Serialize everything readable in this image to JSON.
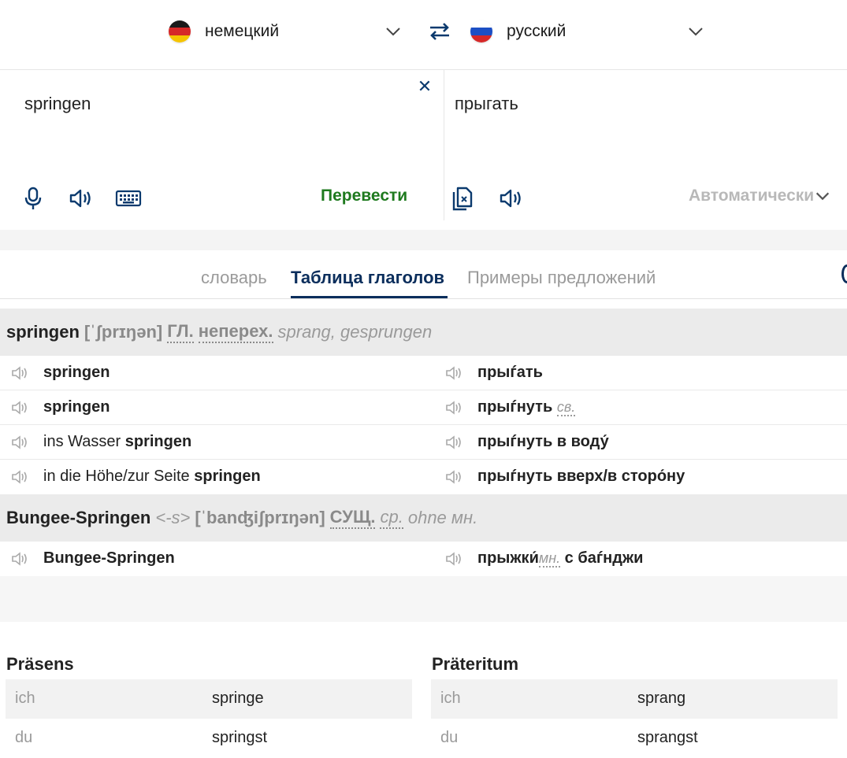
{
  "languages": {
    "source": "немецкий",
    "target": "русский"
  },
  "translator": {
    "source_text": "springen",
    "target_text": "прыгать",
    "translate_label": "Перевести",
    "auto_label": "Автоматически"
  },
  "tabs": [
    "словарь",
    "Таблица глаголов",
    "Примеры предложений"
  ],
  "entries": [
    {
      "headword": "springen",
      "phonetic": "[ˈʃprɪŋən]",
      "pos": "ГЛ.",
      "pos2": "неперех.",
      "forms": "sprang, gesprungen",
      "rows": [
        {
          "de_plain": "",
          "de_bold": "springen",
          "ru_bold": "прыѓать",
          "ru_abbr": ""
        },
        {
          "de_plain": "",
          "de_bold": "springen",
          "ru_bold": "прыѓнуть",
          "ru_abbr": "св."
        },
        {
          "de_plain": "ins Wasser ",
          "de_bold": "springen",
          "ru_bold": "прыѓнуть в воду́",
          "ru_abbr": ""
        },
        {
          "de_plain": "in die Höhe/zur Seite ",
          "de_bold": "springen",
          "ru_bold": "прыѓнуть вверх/в сторо́ну",
          "ru_abbr": ""
        }
      ]
    },
    {
      "headword": "Bungee-Springen",
      "gender": "<-s>",
      "phonetic": "[ˈbanʤiʃprɪŋən]",
      "pos": "СУЩ.",
      "pos2": "ср.",
      "forms": "ohne мн.",
      "rows": [
        {
          "de_plain": "",
          "de_bold": "Bungee-Springen",
          "ru_bold": "прыжки́",
          "ru_abbr": "мн.",
          "ru_tail": " с баѓнджи"
        }
      ]
    }
  ],
  "conjugation": {
    "tables": [
      {
        "title": "Präsens",
        "rows": [
          {
            "pronoun": "ich",
            "form": "springe"
          },
          {
            "pronoun": "du",
            "form": "springst"
          }
        ]
      },
      {
        "title": "Präteritum",
        "rows": [
          {
            "pronoun": "ich",
            "form": "sprang"
          },
          {
            "pronoun": "du",
            "form": "sprangst"
          }
        ]
      }
    ]
  },
  "colors": {
    "accent_navy": "#0b2e5c",
    "translate_green": "#1e7a1e",
    "muted_gray": "#9a9a9a"
  }
}
